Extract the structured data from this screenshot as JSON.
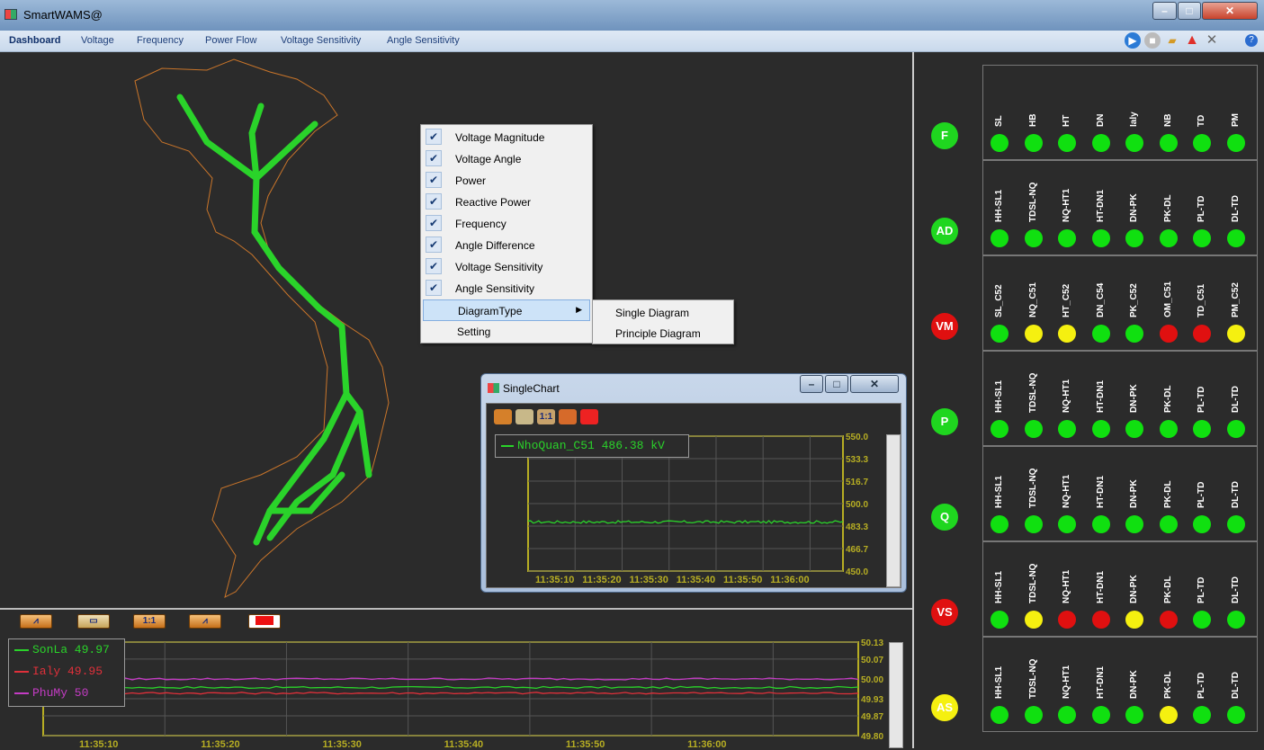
{
  "window": {
    "title": "SmartWAMS@"
  },
  "menu": {
    "tabs": [
      "Dashboard",
      "Voltage",
      "Frequency",
      "Power Flow",
      "Voltage Sensitivity",
      "Angle Sensitivity"
    ]
  },
  "context_menu": {
    "items": [
      {
        "label": "Voltage Magnitude",
        "checked": true
      },
      {
        "label": "Voltage Angle",
        "checked": true
      },
      {
        "label": "Power",
        "checked": true
      },
      {
        "label": "Reactive Power",
        "checked": true
      },
      {
        "label": "Frequency",
        "checked": true
      },
      {
        "label": "Angle Difference",
        "checked": true
      },
      {
        "label": "Voltage Sensitivity",
        "checked": true
      },
      {
        "label": "Angle Sensitivity",
        "checked": true
      },
      {
        "label": "DiagramType",
        "checked": false
      },
      {
        "label": "Setting",
        "checked": false
      }
    ],
    "submenu": [
      "Single Diagram",
      "Principle Diagram"
    ]
  },
  "single_chart": {
    "title": "SingleChart",
    "legend": "NhoQuan_C51 486.38 kV",
    "zoom_label": "1:1",
    "chart_data": {
      "type": "line",
      "x": [
        "11:35:10",
        "11:35:20",
        "11:35:30",
        "11:35:40",
        "11:35:50",
        "11:36:00"
      ],
      "y_ticks": [
        "550.0",
        "533.3",
        "516.7",
        "500.0",
        "483.3",
        "466.7",
        "450.0"
      ],
      "ylim": [
        450.0,
        550.0
      ],
      "series": [
        {
          "name": "NhoQuan_C51",
          "color": "#2ad32a",
          "value": 486.38
        }
      ]
    }
  },
  "bottom_chart": {
    "zoom_label": "1:1",
    "legend": [
      "SonLa 49.97",
      "Ialy 49.95",
      "PhuMy 50"
    ],
    "chart_data": {
      "type": "line",
      "x": [
        "11:35:10",
        "11:35:20",
        "11:35:30",
        "11:35:40",
        "11:35:50",
        "11:36:00"
      ],
      "y_ticks": [
        "50.13",
        "50.07",
        "50.00",
        "49.93",
        "49.87",
        "49.80"
      ],
      "ylim": [
        49.8,
        50.13
      ],
      "series": [
        {
          "name": "SonLa",
          "color": "#2ad32a",
          "value": 49.97
        },
        {
          "name": "Ialy",
          "color": "#e0303a",
          "value": 49.95
        },
        {
          "name": "PhuMy",
          "color": "#c43cc4",
          "value": 50.0
        }
      ]
    }
  },
  "status_panel": {
    "rows": [
      {
        "code": "F",
        "color": "#1fd61f",
        "items": [
          [
            "SL",
            "#10e010"
          ],
          [
            "HB",
            "#10e010"
          ],
          [
            "HT",
            "#10e010"
          ],
          [
            "DN",
            "#10e010"
          ],
          [
            "Ialy",
            "#10e010"
          ],
          [
            "NB",
            "#10e010"
          ],
          [
            "TD",
            "#10e010"
          ],
          [
            "PM",
            "#10e010"
          ]
        ]
      },
      {
        "code": "AD",
        "color": "#1fd61f",
        "items": [
          [
            "HH-SL1",
            "#10e010"
          ],
          [
            "TDSL-NQ",
            "#10e010"
          ],
          [
            "NQ-HT1",
            "#10e010"
          ],
          [
            "HT-DN1",
            "#10e010"
          ],
          [
            "DN-PK",
            "#10e010"
          ],
          [
            "PK-DL",
            "#10e010"
          ],
          [
            "PL-TD",
            "#10e010"
          ],
          [
            "DL-TD",
            "#10e010"
          ]
        ]
      },
      {
        "code": "VM",
        "color": "#e01010",
        "items": [
          [
            "SL_C52",
            "#10e010"
          ],
          [
            "NQ_C51",
            "#f5f010"
          ],
          [
            "HT_C52",
            "#f5f010"
          ],
          [
            "DN_C54",
            "#10e010"
          ],
          [
            "PK_C52",
            "#10e010"
          ],
          [
            "OM_C51",
            "#e01010"
          ],
          [
            "TD_C51",
            "#e01010"
          ],
          [
            "PM_C52",
            "#f5f010"
          ]
        ]
      },
      {
        "code": "P",
        "color": "#1fd61f",
        "items": [
          [
            "HH-SL1",
            "#10e010"
          ],
          [
            "TDSL-NQ",
            "#10e010"
          ],
          [
            "NQ-HT1",
            "#10e010"
          ],
          [
            "HT-DN1",
            "#10e010"
          ],
          [
            "DN-PK",
            "#10e010"
          ],
          [
            "PK-DL",
            "#10e010"
          ],
          [
            "PL-TD",
            "#10e010"
          ],
          [
            "DL-TD",
            "#10e010"
          ]
        ]
      },
      {
        "code": "Q",
        "color": "#1fd61f",
        "items": [
          [
            "HH-SL1",
            "#10e010"
          ],
          [
            "TDSL-NQ",
            "#10e010"
          ],
          [
            "NQ-HT1",
            "#10e010"
          ],
          [
            "HT-DN1",
            "#10e010"
          ],
          [
            "DN-PK",
            "#10e010"
          ],
          [
            "PK-DL",
            "#10e010"
          ],
          [
            "PL-TD",
            "#10e010"
          ],
          [
            "DL-TD",
            "#10e010"
          ]
        ]
      },
      {
        "code": "VS",
        "color": "#e01010",
        "items": [
          [
            "HH-SL1",
            "#10e010"
          ],
          [
            "TDSL-NQ",
            "#f5f010"
          ],
          [
            "NQ-HT1",
            "#e01010"
          ],
          [
            "HT-DN1",
            "#e01010"
          ],
          [
            "DN-PK",
            "#f5f010"
          ],
          [
            "PK-DL",
            "#e01010"
          ],
          [
            "PL-TD",
            "#10e010"
          ],
          [
            "DL-TD",
            "#10e010"
          ]
        ]
      },
      {
        "code": "AS",
        "color": "#f5f010",
        "items": [
          [
            "HH-SL1",
            "#10e010"
          ],
          [
            "TDSL-NQ",
            "#10e010"
          ],
          [
            "NQ-HT1",
            "#10e010"
          ],
          [
            "HT-DN1",
            "#10e010"
          ],
          [
            "DN-PK",
            "#10e010"
          ],
          [
            "PK-DL",
            "#f5f010"
          ],
          [
            "PL-TD",
            "#10e010"
          ],
          [
            "DL-TD",
            "#10e010"
          ]
        ]
      }
    ]
  }
}
